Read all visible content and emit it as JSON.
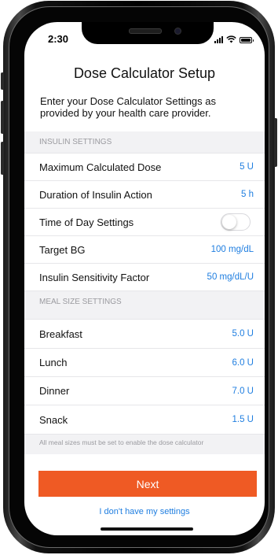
{
  "status_bar": {
    "time": "2:30",
    "signal_icon": "cellular-signal-icon",
    "wifi_icon": "wifi-icon",
    "battery_icon": "battery-icon"
  },
  "header": {
    "title": "Dose Calculator Setup"
  },
  "intro_text": "Enter your Dose Calculator Settings as provided by your health care provider.",
  "insulin_settings": {
    "header": "INSULIN SETTINGS",
    "rows": [
      {
        "label": "Maximum Calculated Dose",
        "value": "5 U"
      },
      {
        "label": "Duration of Insulin Action",
        "value": "5 h"
      },
      {
        "label": "Time of Day Settings",
        "toggle_on": false
      },
      {
        "label": "Target BG",
        "value": "100 mg/dL"
      },
      {
        "label": "Insulin Sensitivity Factor",
        "value": "50 mg/dL/U"
      }
    ]
  },
  "meal_size_settings": {
    "header": "MEAL SIZE SETTINGS",
    "rows": [
      {
        "label": "Breakfast",
        "value": "5.0 U"
      },
      {
        "label": "Lunch",
        "value": "6.0 U"
      },
      {
        "label": "Dinner",
        "value": "7.0 U"
      },
      {
        "label": "Snack",
        "value": "1.5 U"
      }
    ]
  },
  "footnote": "All meal sizes must be set to enable the dose calculator",
  "actions": {
    "next_label": "Next",
    "no_settings_link": "I don't have my settings"
  },
  "colors": {
    "accent_blue": "#1f7ee0",
    "primary_button": "#ef5a24",
    "section_background": "#f2f2f4",
    "section_text": "#9a9a9f"
  }
}
